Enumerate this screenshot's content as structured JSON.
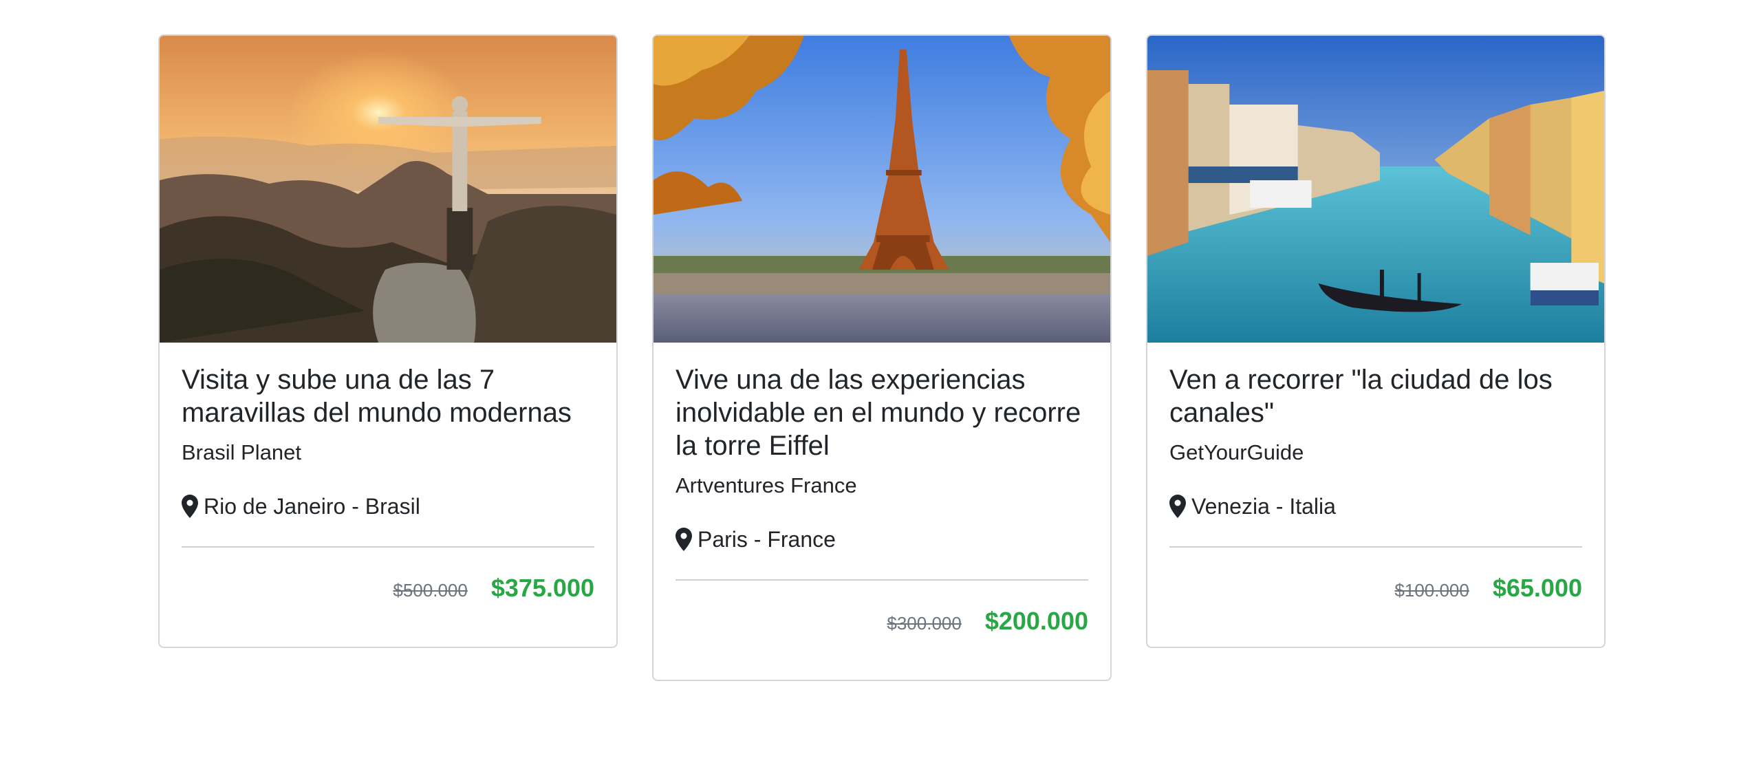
{
  "cards": [
    {
      "image_alt": "Cristo Redentor sobre Rio de Janeiro al atardecer",
      "title": "Visita y sube una de las 7 maravillas del mundo modernas",
      "provider": "Brasil Planet",
      "location": "Rio de Janeiro - Brasil",
      "old_price": "$500.000",
      "price": "$375.000"
    },
    {
      "image_alt": "Torre Eiffel con árboles otoñales",
      "title": "Vive una de las experiencias inolvidable en el mundo y recorre la torre Eiffel",
      "provider": "Artventures France",
      "location": "Paris - France",
      "old_price": "$300.000",
      "price": "$200.000"
    },
    {
      "image_alt": "Gran Canal de Venecia con góndola",
      "title": "Ven a recorrer \"la ciudad de los canales\"",
      "provider": "GetYourGuide",
      "location": "Venezia - Italia",
      "old_price": "$100.000",
      "price": "$65.000"
    }
  ],
  "colors": {
    "price_green": "#28a745",
    "old_price_gray": "#6c757d",
    "border": "#d5d5d5"
  },
  "icons": {
    "location": "map-marker-icon"
  }
}
